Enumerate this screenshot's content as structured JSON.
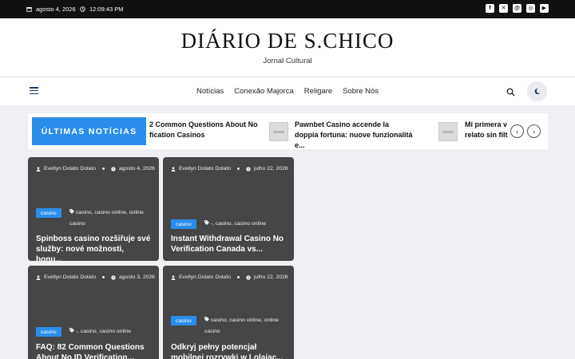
{
  "topbar": {
    "date": "agosto 4, 2026",
    "time": "12:09:43 PM",
    "social_icons": [
      "facebook-icon",
      "x-icon",
      "threads-icon",
      "instagram-icon",
      "youtube-icon"
    ]
  },
  "header": {
    "site_title": "DIÁRIO DE S.CHICO",
    "tagline": "Jornal Cultural"
  },
  "nav": {
    "items": [
      "Notícias",
      "Conexão Majorca",
      "Religare",
      "Sobre Nós"
    ]
  },
  "ticker": {
    "label": "ÚLTIMAS NOTÍCIAS",
    "items": [
      {
        "title": "2 Common Questions About No fication Casinos"
      },
      {
        "title": "Pawnbet Casino accende la doppia fortuna: nuove funzionalità e..."
      },
      {
        "title": "Mi primera v relato sin filt"
      }
    ]
  },
  "posts": [
    {
      "author": "Evellyn Dolato Dolato",
      "date": "agosto 4, 2026",
      "category": "casino",
      "tags": "casino, casino online, online casino",
      "title": "Spinboss casino rozšiřuje své služby: nové možnosti, bonu..."
    },
    {
      "author": "Evellyn Dolato Dolato",
      "date": "julho 22, 2026",
      "category": "casino",
      "tags": "-, casino, casino online",
      "title": "Instant Withdrawal Casino No Verification Canada vs..."
    },
    {
      "author": "Evellyn Dolato Dolato",
      "date": "agosto 3, 2026",
      "category": "casino",
      "tags": "-, casino, casino online",
      "title": "FAQ: 82 Common Questions About No ID Verification..."
    },
    {
      "author": "Evellyn Dolato Dolato",
      "date": "julho 22, 2026",
      "category": "casino",
      "tags": "casino, casino online, online casino",
      "title": "Odkryj pełny potencjał mobilnej rozrywki w Lolajac..."
    }
  ],
  "colors": {
    "accent": "#2a8de9",
    "topbar_bg": "#111111",
    "card_bg": "#464646",
    "page_bg": "#eef0f3"
  }
}
